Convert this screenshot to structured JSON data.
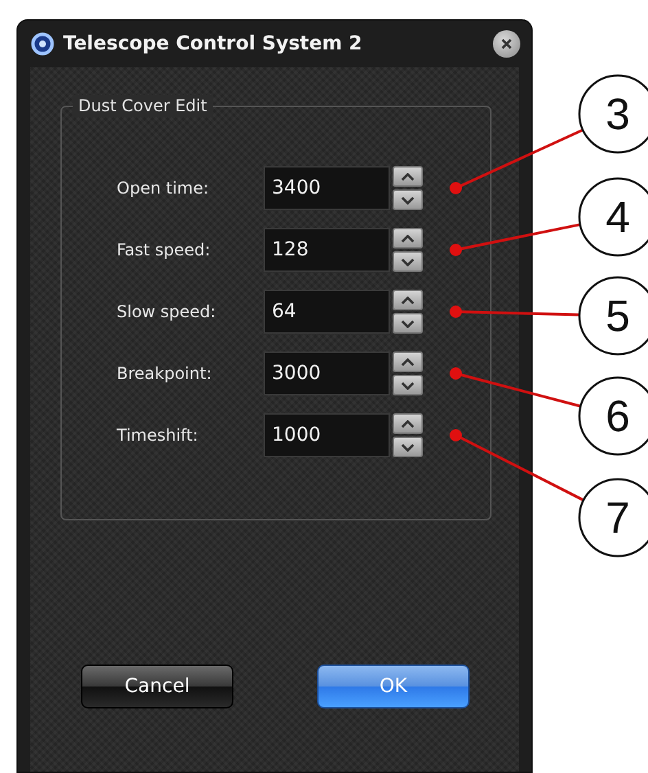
{
  "window": {
    "title": "Telescope Control System 2"
  },
  "group": {
    "title": "Dust Cover Edit"
  },
  "fields": [
    {
      "label": "Open time:",
      "value": "3400",
      "callout": "3"
    },
    {
      "label": "Fast speed:",
      "value": "128",
      "callout": "4"
    },
    {
      "label": "Slow speed:",
      "value": "64",
      "callout": "5"
    },
    {
      "label": "Breakpoint:",
      "value": "3000",
      "callout": "6"
    },
    {
      "label": "Timeshift:",
      "value": "1000",
      "callout": "7"
    }
  ],
  "buttons": [
    {
      "label": "Cancel",
      "kind": "secondary"
    },
    {
      "label": "OK",
      "kind": "primary"
    }
  ]
}
